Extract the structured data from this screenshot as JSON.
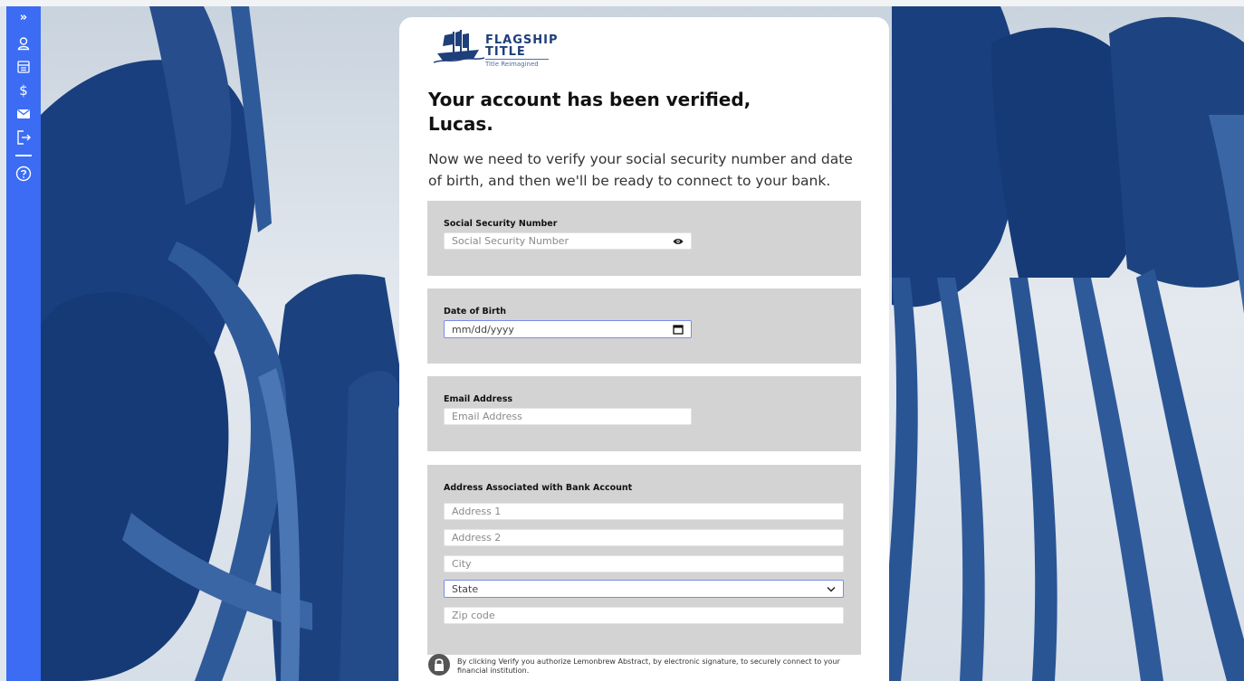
{
  "sidebar": {
    "items": [
      {
        "icon": "chevron-double-right-icon"
      },
      {
        "icon": "user-icon"
      },
      {
        "icon": "building-icon"
      },
      {
        "icon": "dollar-icon",
        "glyph": "$"
      },
      {
        "icon": "mail-icon"
      },
      {
        "icon": "logout-icon"
      },
      {
        "icon": "help-icon"
      }
    ],
    "expand_glyph": "»"
  },
  "logo": {
    "line1": "FLAGSHIP",
    "line2": "TITLE",
    "tagline": "Title Reimagined"
  },
  "heading": "Your account has been verified, Lucas.",
  "intro": "Now we need to verify your social security number and date of birth, and then we'll be ready to connect to your bank.",
  "ssn": {
    "label": "Social Security Number",
    "placeholder": "Social Security Number"
  },
  "dob": {
    "label": "Date of Birth",
    "placeholder": "mm/dd/yyyy"
  },
  "email": {
    "label": "Email Address",
    "placeholder": "Email Address"
  },
  "address": {
    "label": "Address Associated with Bank Account",
    "address1": "Address 1",
    "address2": "Address 2",
    "city": "City",
    "state": "State",
    "zip": "Zip code"
  },
  "consent": "By clicking Verify you authorize Lemonbrew Abstract, by electronic signature, to securely connect to your financial institution.",
  "colors": {
    "sidebar": "#3b6cf3",
    "brand": "#1f3f7a",
    "photo_tint": "#163c7a",
    "panel": "#d3d3d3"
  }
}
